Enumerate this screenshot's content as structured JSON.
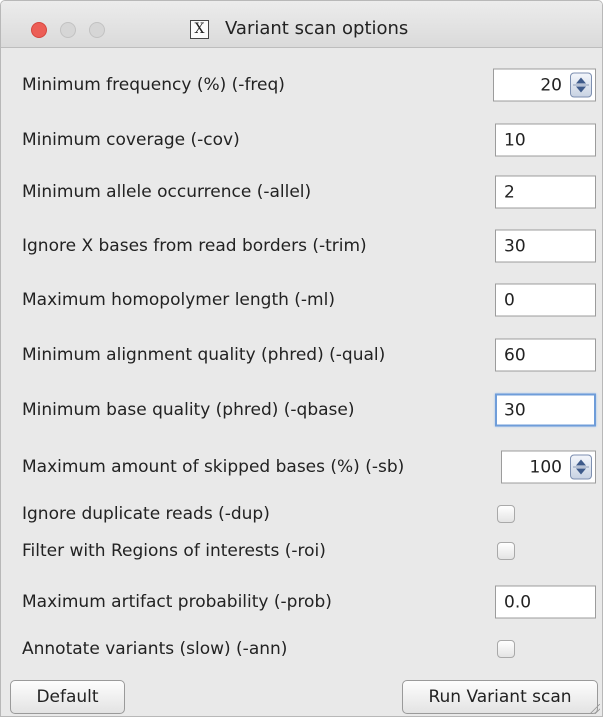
{
  "window": {
    "title": "Variant scan options",
    "title_icon": "X"
  },
  "options": {
    "freq": {
      "label": "Minimum frequency (%) (-freq)",
      "value": "20"
    },
    "cov": {
      "label": "Minimum coverage (-cov)",
      "value": "10"
    },
    "allel": {
      "label": "Minimum allele occurrence (-allel)",
      "value": "2"
    },
    "trim": {
      "label": "Ignore X bases from read borders (-trim)",
      "value": "30"
    },
    "ml": {
      "label": "Maximum homopolymer length (-ml)",
      "value": "0"
    },
    "qual": {
      "label": "Minimum alignment quality (phred) (-qual)",
      "value": "60"
    },
    "qbase": {
      "label": "Minimum base quality (phred) (-qbase)",
      "value": "30"
    },
    "sb": {
      "label": "Maximum amount of skipped bases (%) (-sb)",
      "value": "100"
    },
    "dup": {
      "label": "Ignore duplicate reads (-dup)",
      "checked": false
    },
    "roi": {
      "label": "Filter with Regions of interests (-roi)",
      "checked": false
    },
    "prob": {
      "label": "Maximum artifact probability (-prob)",
      "value": "0.0"
    },
    "ann": {
      "label": "Annotate variants (slow) (-ann)",
      "checked": false
    }
  },
  "buttons": {
    "default_label": "Default",
    "run_label": "Run Variant scan"
  },
  "colors": {
    "close": "#ec5e56",
    "focus_ring": "#6f9dd9",
    "spinner_arrow": "#3e5a8a"
  }
}
